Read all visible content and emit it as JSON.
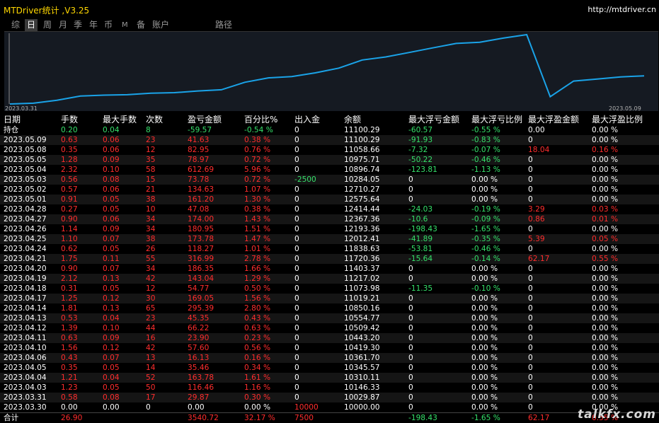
{
  "window": {
    "title": "MTDriver统计 ,V3.25",
    "url": "http://mtdriver.cn"
  },
  "tabs": [
    "综",
    "日",
    "周",
    "月",
    "季",
    "年",
    "币",
    "M",
    "备",
    "账户",
    "路径"
  ],
  "active_tab": "日",
  "chart": {
    "start_label": "2023.03.31",
    "end_label": "2023.05.09",
    "line_color": "#1aa3e8",
    "balance_series": [
      10000.0,
      10029.87,
      10146.33,
      10310.11,
      10345.57,
      10361.7,
      10419.3,
      10443.2,
      10509.42,
      10554.77,
      10850.16,
      11019.21,
      11073.98,
      11217.02,
      11403.37,
      11720.36,
      11838.63,
      12012.41,
      12193.36,
      12367.36,
      12414.44,
      12575.64,
      12710.27,
      10284.05,
      10896.74,
      10975.71,
      11058.66,
      11100.29
    ]
  },
  "columns": [
    "日期",
    "手数",
    "最大手数",
    "次数",
    "盈亏金额",
    "百分比%",
    "出入金",
    "余额",
    "最大浮亏金额",
    "最大浮亏比例",
    "最大浮盈金额",
    "最大浮盈比例"
  ],
  "holding": {
    "label": "持仓",
    "lots": "0.20",
    "max_lots": "0.04",
    "count": "8",
    "pnl": "-59.57",
    "pct": "-0.54 %",
    "flow": "0",
    "balance": "11100.29",
    "max_float_loss": "-60.57",
    "max_float_loss_pct": "-0.55 %",
    "max_float_profit": "0.00",
    "max_float_profit_pct": "0.00 %"
  },
  "rows": [
    [
      "2023.05.09",
      "0.63",
      "0.06",
      "23",
      "41.63",
      "0.38 %",
      "0",
      "11100.29",
      "-91.93",
      "-0.83 %",
      "0",
      "0.00 %"
    ],
    [
      "2023.05.08",
      "0.35",
      "0.06",
      "12",
      "82.95",
      "0.76 %",
      "0",
      "11058.66",
      "-7.32",
      "-0.07 %",
      "18.04",
      "0.16 %"
    ],
    [
      "2023.05.05",
      "1.28",
      "0.09",
      "35",
      "78.97",
      "0.72 %",
      "0",
      "10975.71",
      "-50.22",
      "-0.46 %",
      "0",
      "0.00 %"
    ],
    [
      "2023.05.04",
      "2.32",
      "0.10",
      "58",
      "612.69",
      "5.96 %",
      "0",
      "10896.74",
      "-123.81",
      "-1.13 %",
      "0",
      "0.00 %"
    ],
    [
      "2023.05.03",
      "0.56",
      "0.08",
      "15",
      "73.78",
      "0.72 %",
      "-2500",
      "10284.05",
      "0",
      "0.00 %",
      "0",
      "0.00 %"
    ],
    [
      "2023.05.02",
      "0.57",
      "0.06",
      "21",
      "134.63",
      "1.07 %",
      "0",
      "12710.27",
      "0",
      "0.00 %",
      "0",
      "0.00 %"
    ],
    [
      "2023.05.01",
      "0.91",
      "0.05",
      "38",
      "161.20",
      "1.30 %",
      "0",
      "12575.64",
      "0",
      "0.00 %",
      "0",
      "0.00 %"
    ],
    [
      "2023.04.28",
      "0.27",
      "0.05",
      "10",
      "47.08",
      "0.38 %",
      "0",
      "12414.44",
      "-24.03",
      "-0.19 %",
      "3.29",
      "0.03 %"
    ],
    [
      "2023.04.27",
      "0.90",
      "0.06",
      "34",
      "174.00",
      "1.43 %",
      "0",
      "12367.36",
      "-10.6",
      "-0.09 %",
      "0.86",
      "0.01 %"
    ],
    [
      "2023.04.26",
      "1.14",
      "0.09",
      "34",
      "180.95",
      "1.51 %",
      "0",
      "12193.36",
      "-198.43",
      "-1.65 %",
      "0",
      "0.00 %"
    ],
    [
      "2023.04.25",
      "1.10",
      "0.07",
      "38",
      "173.78",
      "1.47 %",
      "0",
      "12012.41",
      "-41.89",
      "-0.35 %",
      "5.39",
      "0.05 %"
    ],
    [
      "2023.04.24",
      "0.62",
      "0.05",
      "26",
      "118.27",
      "1.01 %",
      "0",
      "11838.63",
      "-53.81",
      "-0.46 %",
      "0",
      "0.00 %"
    ],
    [
      "2023.04.21",
      "1.75",
      "0.11",
      "55",
      "316.99",
      "2.78 %",
      "0",
      "11720.36",
      "-15.64",
      "-0.14 %",
      "62.17",
      "0.55 %"
    ],
    [
      "2023.04.20",
      "0.90",
      "0.07",
      "34",
      "186.35",
      "1.66 %",
      "0",
      "11403.37",
      "0",
      "0.00 %",
      "0",
      "0.00 %"
    ],
    [
      "2023.04.19",
      "2.12",
      "0.13",
      "42",
      "143.04",
      "1.29 %",
      "0",
      "11217.02",
      "0",
      "0.00 %",
      "0",
      "0.00 %"
    ],
    [
      "2023.04.18",
      "0.31",
      "0.05",
      "12",
      "54.77",
      "0.50 %",
      "0",
      "11073.98",
      "-11.35",
      "-0.10 %",
      "0",
      "0.00 %"
    ],
    [
      "2023.04.17",
      "1.25",
      "0.12",
      "30",
      "169.05",
      "1.56 %",
      "0",
      "11019.21",
      "0",
      "0.00 %",
      "0",
      "0.00 %"
    ],
    [
      "2023.04.14",
      "1.81",
      "0.13",
      "65",
      "295.39",
      "2.80 %",
      "0",
      "10850.16",
      "0",
      "0.00 %",
      "0",
      "0.00 %"
    ],
    [
      "2023.04.13",
      "0.53",
      "0.04",
      "23",
      "45.35",
      "0.43 %",
      "0",
      "10554.77",
      "0",
      "0.00 %",
      "0",
      "0.00 %"
    ],
    [
      "2023.04.12",
      "1.39",
      "0.10",
      "44",
      "66.22",
      "0.63 %",
      "0",
      "10509.42",
      "0",
      "0.00 %",
      "0",
      "0.00 %"
    ],
    [
      "2023.04.11",
      "0.63",
      "0.09",
      "16",
      "23.90",
      "0.23 %",
      "0",
      "10443.20",
      "0",
      "0.00 %",
      "0",
      "0.00 %"
    ],
    [
      "2023.04.10",
      "1.56",
      "0.12",
      "42",
      "57.60",
      "0.56 %",
      "0",
      "10419.30",
      "0",
      "0.00 %",
      "0",
      "0.00 %"
    ],
    [
      "2023.04.06",
      "0.43",
      "0.07",
      "13",
      "16.13",
      "0.16 %",
      "0",
      "10361.70",
      "0",
      "0.00 %",
      "0",
      "0.00 %"
    ],
    [
      "2023.04.05",
      "0.35",
      "0.05",
      "14",
      "35.46",
      "0.34 %",
      "0",
      "10345.57",
      "0",
      "0.00 %",
      "0",
      "0.00 %"
    ],
    [
      "2023.04.04",
      "1.21",
      "0.04",
      "52",
      "163.78",
      "1.61 %",
      "0",
      "10310.11",
      "0",
      "0.00 %",
      "0",
      "0.00 %"
    ],
    [
      "2023.04.03",
      "1.23",
      "0.05",
      "50",
      "116.46",
      "1.16 %",
      "0",
      "10146.33",
      "0",
      "0.00 %",
      "0",
      "0.00 %"
    ],
    [
      "2023.03.31",
      "0.58",
      "0.08",
      "17",
      "29.87",
      "0.30 %",
      "0",
      "10029.87",
      "0",
      "0.00 %",
      "0",
      "0.00 %"
    ],
    [
      "2023.03.30",
      "0.00",
      "0.00",
      "0",
      "0.00",
      "0.00 %",
      "10000",
      "10000.00",
      "0",
      "0.00 %",
      "0",
      "0.00 %"
    ]
  ],
  "total": {
    "label": "合计",
    "lots": "26.90",
    "max_lots": "",
    "count": "",
    "pnl": "3540.72",
    "pct": "32.17 %",
    "flow": "7500",
    "balance": "",
    "max_float_loss": "-198.43",
    "max_float_loss_pct": "-1.65 %",
    "max_float_profit": "62.17",
    "max_float_profit_pct": "0.55 %"
  },
  "watermark": "talkfx.com",
  "colors": {
    "positive": "#ff2d2d",
    "negative": "#35e06a",
    "title": "#ffd700",
    "line": "#1aa3e8"
  }
}
